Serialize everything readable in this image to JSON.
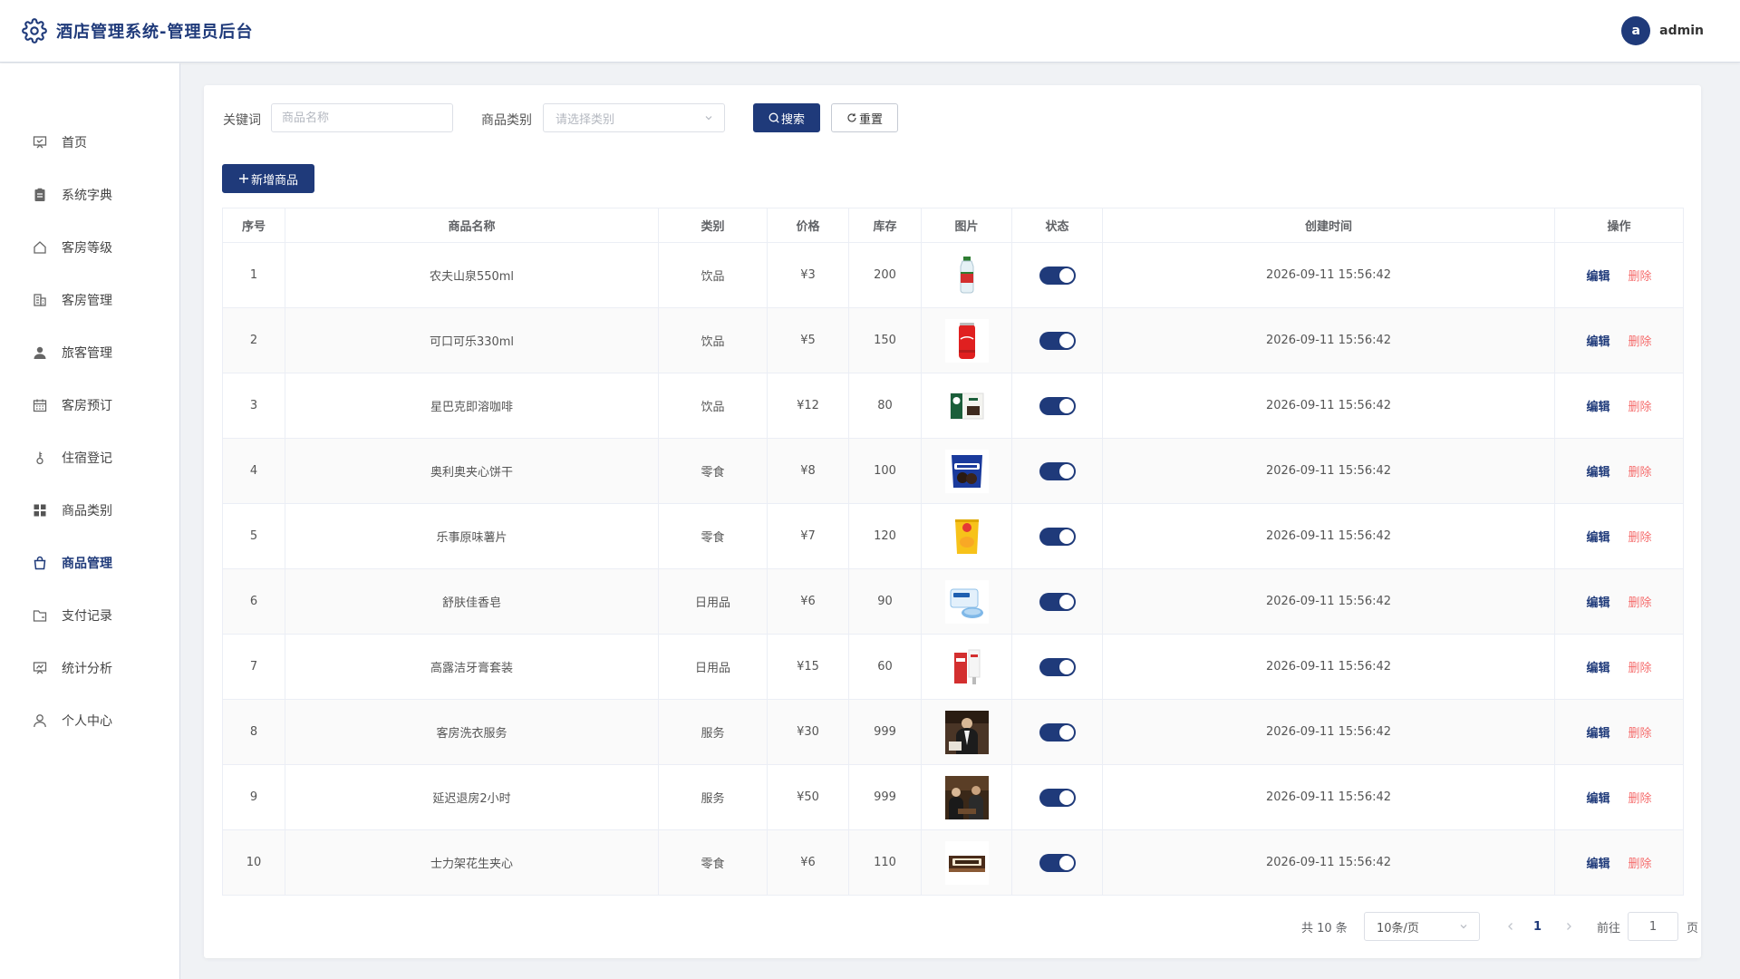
{
  "header": {
    "title": "酒店管理系统-管理员后台",
    "avatar_letter": "a",
    "username": "admin"
  },
  "sidebar": {
    "items": [
      {
        "label": "首页",
        "icon": "dashboard-icon",
        "active": false
      },
      {
        "label": "系统字典",
        "icon": "clipboard-icon",
        "active": false
      },
      {
        "label": "客房等级",
        "icon": "home-icon",
        "active": false
      },
      {
        "label": "客房管理",
        "icon": "building-icon",
        "active": false
      },
      {
        "label": "旅客管理",
        "icon": "user-icon",
        "active": false
      },
      {
        "label": "客房预订",
        "icon": "calendar-icon",
        "active": false
      },
      {
        "label": "住宿登记",
        "icon": "key-icon",
        "active": false
      },
      {
        "label": "商品类别",
        "icon": "grid-icon",
        "active": false
      },
      {
        "label": "商品管理",
        "icon": "bag-icon",
        "active": true
      },
      {
        "label": "支付记录",
        "icon": "folder-icon",
        "active": false
      },
      {
        "label": "统计分析",
        "icon": "chart-icon",
        "active": false
      },
      {
        "label": "个人中心",
        "icon": "profile-icon",
        "active": false
      }
    ]
  },
  "filter": {
    "keyword_label": "关键词",
    "keyword_placeholder": "商品名称",
    "keyword_value": "",
    "category_label": "商品类别",
    "category_placeholder": "请选择类别",
    "search_label": "搜索",
    "reset_label": "重置"
  },
  "toolbar": {
    "add_label": "新增商品"
  },
  "table": {
    "columns": [
      "序号",
      "商品名称",
      "类别",
      "价格",
      "库存",
      "图片",
      "状态",
      "创建时间",
      "操作"
    ],
    "edit_label": "编辑",
    "delete_label": "删除",
    "rows": [
      {
        "no": "1",
        "name": "农夫山泉550ml",
        "category": "饮品",
        "price": "¥3",
        "stock": "200",
        "image": "water-bottle-image",
        "enabled": true,
        "created": "2026-09-11 15:56:42"
      },
      {
        "no": "2",
        "name": "可口可乐330ml",
        "category": "饮品",
        "price": "¥5",
        "stock": "150",
        "image": "cola-can-image",
        "enabled": true,
        "created": "2026-09-11 15:56:42"
      },
      {
        "no": "3",
        "name": "星巴克即溶咖啡",
        "category": "饮品",
        "price": "¥12",
        "stock": "80",
        "image": "coffee-box-image",
        "enabled": true,
        "created": "2026-09-11 15:56:42"
      },
      {
        "no": "4",
        "name": "奥利奥夹心饼干",
        "category": "零食",
        "price": "¥8",
        "stock": "100",
        "image": "cookie-pack-image",
        "enabled": true,
        "created": "2026-09-11 15:56:42"
      },
      {
        "no": "5",
        "name": "乐事原味薯片",
        "category": "零食",
        "price": "¥7",
        "stock": "120",
        "image": "chips-bag-image",
        "enabled": true,
        "created": "2026-09-11 15:56:42"
      },
      {
        "no": "6",
        "name": "舒肤佳香皂",
        "category": "日用品",
        "price": "¥6",
        "stock": "90",
        "image": "soap-image",
        "enabled": true,
        "created": "2026-09-11 15:56:42"
      },
      {
        "no": "7",
        "name": "高露洁牙膏套装",
        "category": "日用品",
        "price": "¥15",
        "stock": "60",
        "image": "toothpaste-image",
        "enabled": true,
        "created": "2026-09-11 15:56:42"
      },
      {
        "no": "8",
        "name": "客房洗衣服务",
        "category": "服务",
        "price": "¥30",
        "stock": "999",
        "image": "laundry-photo-image",
        "enabled": true,
        "created": "2026-09-11 15:56:42"
      },
      {
        "no": "9",
        "name": "延迟退房2小时",
        "category": "服务",
        "price": "¥50",
        "stock": "999",
        "image": "checkout-photo-image",
        "enabled": true,
        "created": "2026-09-11 15:56:42"
      },
      {
        "no": "10",
        "name": "士力架花生夹心",
        "category": "零食",
        "price": "¥6",
        "stock": "110",
        "image": "snickers-bar-image",
        "enabled": true,
        "created": "2026-09-11 15:56:42"
      }
    ]
  },
  "pagination": {
    "total_label": "共 10 条",
    "page_size": "10条/页",
    "current_page": "1",
    "goto_label": "前往",
    "goto_value": "1",
    "page_unit": "页"
  }
}
